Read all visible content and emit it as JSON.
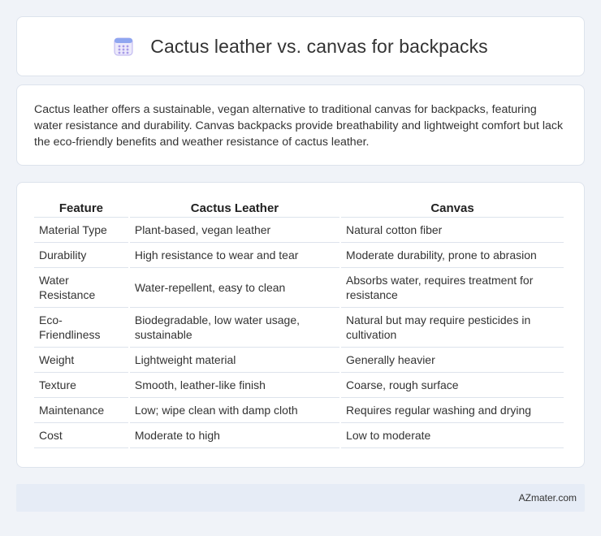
{
  "header": {
    "title": "Cactus leather vs. canvas for backpacks",
    "icon": "calendar-icon"
  },
  "description": "Cactus leather offers a sustainable, vegan alternative to traditional canvas for backpacks, featuring water resistance and durability. Canvas backpacks provide breathability and lightweight comfort but lack the eco-friendly benefits and weather resistance of cactus leather.",
  "table": {
    "headers": [
      "Feature",
      "Cactus Leather",
      "Canvas"
    ],
    "rows": [
      [
        "Material Type",
        "Plant-based, vegan leather",
        "Natural cotton fiber"
      ],
      [
        "Durability",
        "High resistance to wear and tear",
        "Moderate durability, prone to abrasion"
      ],
      [
        "Water Resistance",
        "Water-repellent, easy to clean",
        "Absorbs water, requires treatment for resistance"
      ],
      [
        "Eco-Friendliness",
        "Biodegradable, low water usage, sustainable",
        "Natural but may require pesticides in cultivation"
      ],
      [
        "Weight",
        "Lightweight material",
        "Generally heavier"
      ],
      [
        "Texture",
        "Smooth, leather-like finish",
        "Coarse, rough surface"
      ],
      [
        "Maintenance",
        "Low; wipe clean with damp cloth",
        "Requires regular washing and drying"
      ],
      [
        "Cost",
        "Moderate to high",
        "Low to moderate"
      ]
    ]
  },
  "footer": {
    "brand": "AZmater.com"
  },
  "colors": {
    "background": "#f0f3f8",
    "card": "#ffffff",
    "footer": "#e6ecf6",
    "icon_accent": "#8a7fe0"
  }
}
